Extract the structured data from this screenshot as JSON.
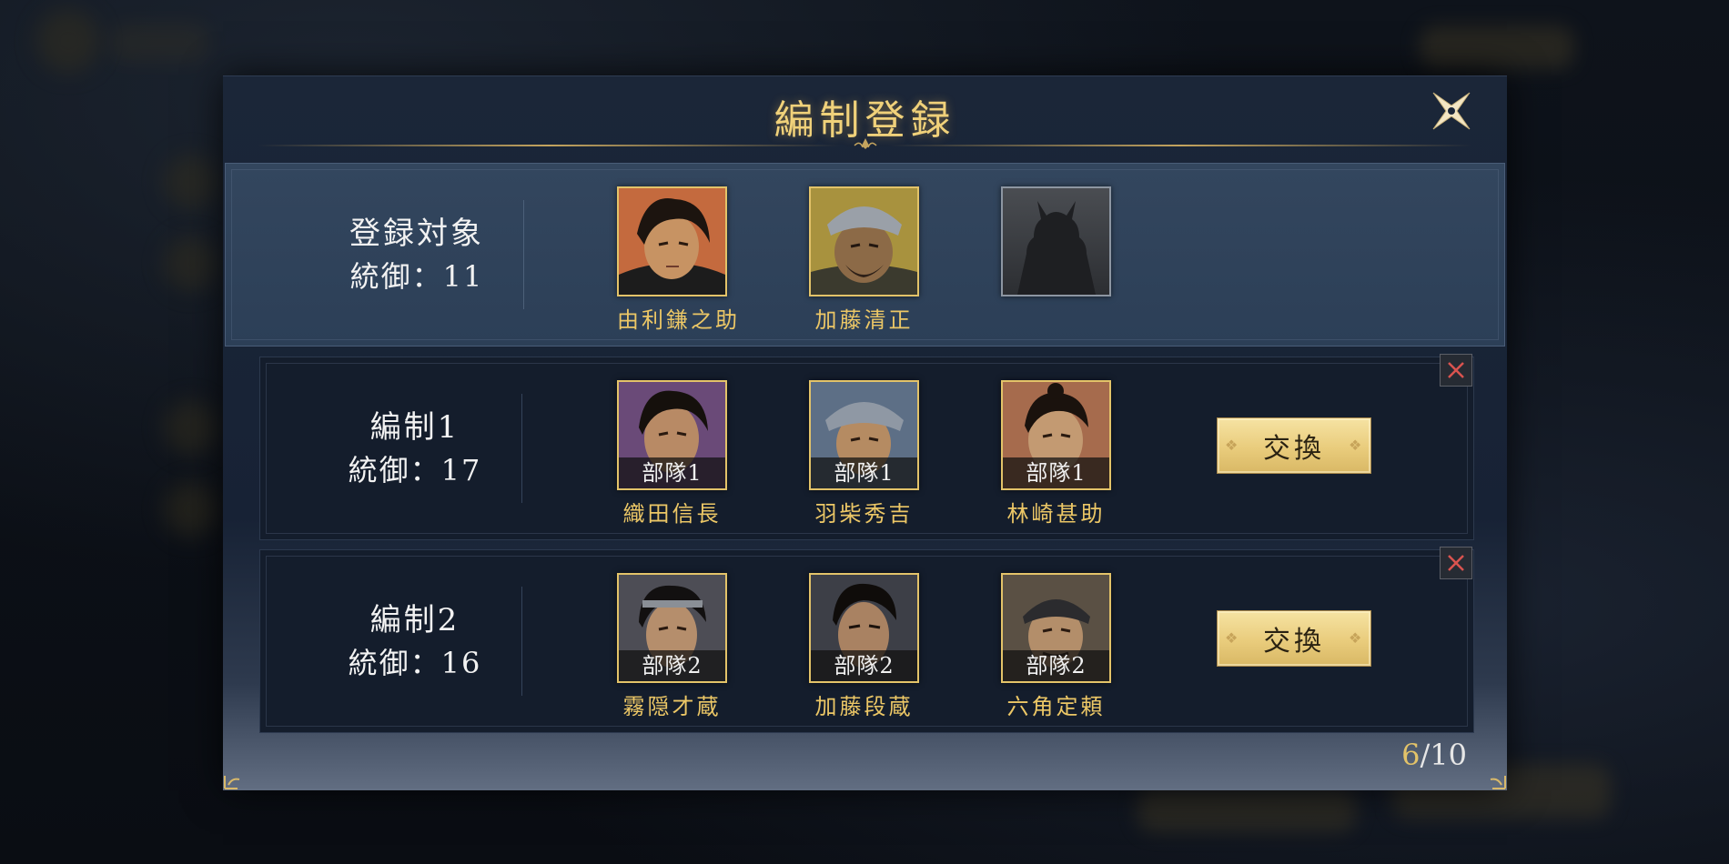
{
  "dialog": {
    "title": "編制登録",
    "close_icon": "close-shuriken-icon",
    "counter_current": "6",
    "counter_sep": "/",
    "counter_total": "10"
  },
  "colors": {
    "gold": "#e3c369",
    "title_gold": "#f0d17a",
    "panel": "#172235",
    "button": "#e9cc7c"
  },
  "target": {
    "name": "登録対象",
    "command": "統御：11",
    "slots": [
      {
        "hero": "由利鎌之助",
        "portrait": "yuri-kamanosuke-portrait",
        "skin": "#c79363",
        "bg": "#c46a3e"
      },
      {
        "hero": "加藤清正",
        "portrait": "kato-kiyomasa-portrait",
        "skin": "#8c6a47",
        "bg": "#a8923e"
      },
      {
        "hero": "",
        "portrait": "empty-slot-silhouette-icon"
      }
    ]
  },
  "formations": [
    {
      "name": "編制1",
      "command": "統御：17",
      "swap_label": "交換",
      "slots": [
        {
          "hero": "織田信長",
          "unit": "部隊1",
          "portrait": "oda-nobunaga-portrait",
          "skin": "#b88a65",
          "bg": "#6a4a78"
        },
        {
          "hero": "羽柴秀吉",
          "unit": "部隊1",
          "portrait": "hashiba-hideyoshi-portrait",
          "skin": "#b58b62",
          "bg": "#5d6f86"
        },
        {
          "hero": "林崎甚助",
          "unit": "部隊1",
          "portrait": "hayashizaki-jinsuke-portrait",
          "skin": "#c39a72",
          "bg": "#a66b4d"
        }
      ]
    },
    {
      "name": "編制2",
      "command": "統御：16",
      "swap_label": "交換",
      "slots": [
        {
          "hero": "霧隠才蔵",
          "unit": "部隊2",
          "portrait": "kirigakure-saizo-portrait",
          "skin": "#b58e6c",
          "bg": "#4d4d55"
        },
        {
          "hero": "加藤段蔵",
          "unit": "部隊2",
          "portrait": "kato-danzo-portrait",
          "skin": "#a98262",
          "bg": "#3d3f47"
        },
        {
          "hero": "六角定頼",
          "unit": "部隊2",
          "portrait": "rokkaku-sadayori-portrait",
          "skin": "#b38e6a",
          "bg": "#5a5044"
        }
      ]
    }
  ]
}
